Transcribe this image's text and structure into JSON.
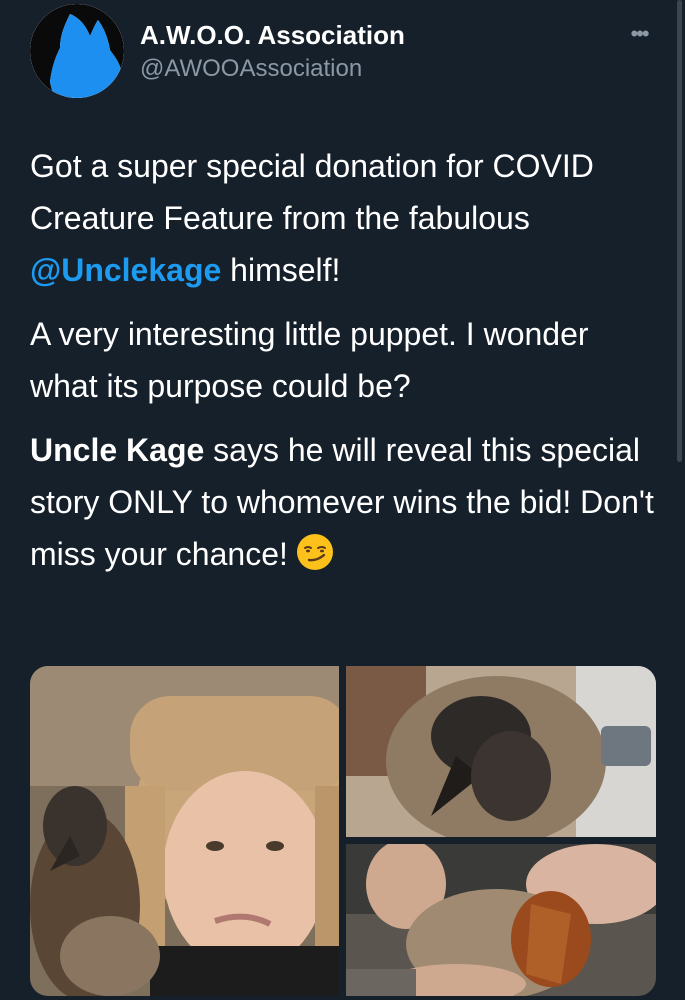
{
  "account": {
    "display_name": "A.W.O.O. Association",
    "handle": "@AWOOAssociation",
    "avatar_icon": "wolf-silhouette-icon",
    "more_icon": "more-options-icon"
  },
  "tweet": {
    "paragraph1_a": "Got a super special donation for COVID Creature Feature from the fabulous ",
    "paragraph1_mention": "@Unclekage",
    "paragraph1_b": " himself!",
    "paragraph2": "A very interesting little puppet. I wonder what its purpose could be?",
    "paragraph3_strong": "Uncle Kage",
    "paragraph3_a": " says he will reveal this special story ONLY to whomever wins the bid! Don't miss your chance!",
    "emoji_icon": "smirking-face-emoji"
  },
  "colors": {
    "background": "#15202b",
    "text": "#ffffff",
    "secondary_text": "#8b98a5",
    "accent": "#1d9bf0"
  },
  "media": {
    "photo_count": 3
  }
}
